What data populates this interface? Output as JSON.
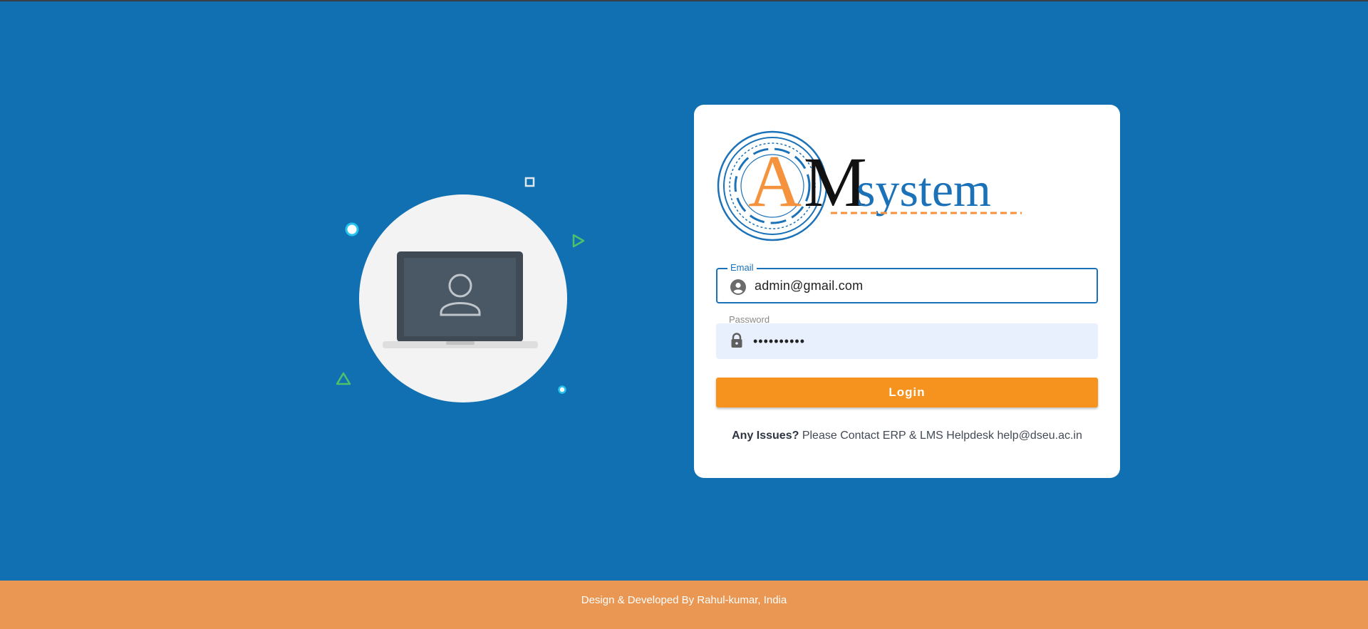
{
  "illustration": {
    "icons": [
      "laptop-icon",
      "user-icon",
      "circle-icon",
      "square-icon",
      "triangle-icon",
      "play-triangle-icon"
    ]
  },
  "logo": {
    "letter_a": "A",
    "letter_m": "M",
    "word": "system",
    "colors": {
      "a": "#f5923e",
      "m": "#111111",
      "word": "#1b72b8"
    }
  },
  "form": {
    "email": {
      "label": "Email",
      "value": "admin@gmail.com",
      "icon": "account-circle-icon"
    },
    "password": {
      "label": "Password",
      "value": "••••••••••",
      "icon": "lock-icon"
    },
    "login_label": "Login"
  },
  "issues": {
    "bold": "Any Issues?",
    "text": " Please Contact ERP & LMS Helpdesk help@dseu.ac.in"
  },
  "footer": {
    "text": "Design & Developed By Rahul-kumar, India"
  },
  "colors": {
    "background": "#1070b1",
    "accent": "#f5931e",
    "footer": "#e99753",
    "primary": "#1b72b8"
  }
}
